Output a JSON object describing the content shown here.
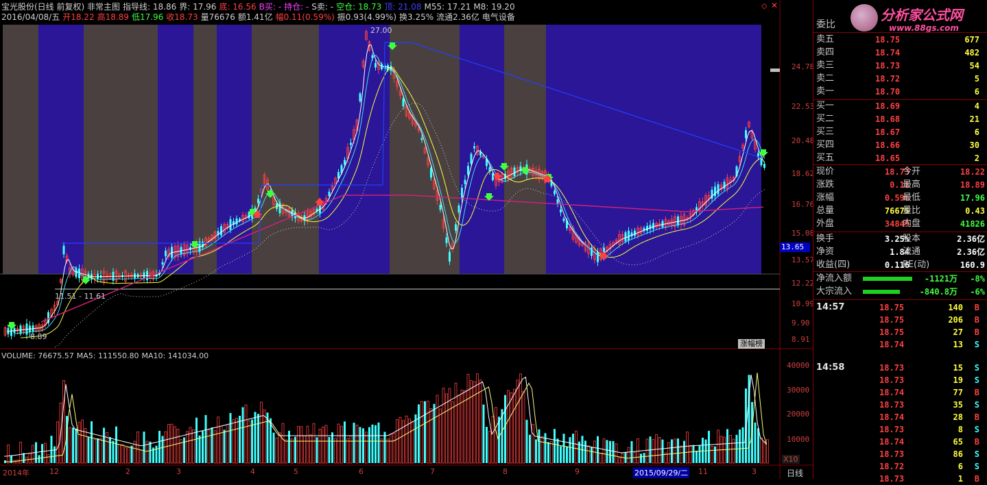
{
  "header": {
    "line1": [
      {
        "text": "宝光股份(日线 前复权) 非常主图",
        "color": "#d0d0d0"
      },
      {
        "text": "指导线: 18.86",
        "color": "#d0d0d0"
      },
      {
        "text": "界: 17.96",
        "color": "#d0d0d0"
      },
      {
        "text": "底: 16.56",
        "color": "#ff4040"
      },
      {
        "text": "B买: -",
        "color": "#ff40ff"
      },
      {
        "text": "持仓: -",
        "color": "#ff40ff"
      },
      {
        "text": "S卖: -",
        "color": "#d0d0d0"
      },
      {
        "text": "空仓: 18.73",
        "color": "#40ff40"
      },
      {
        "text": "顶: 21.08",
        "color": "#4040ff"
      },
      {
        "text": "M55: 17.21",
        "color": "#d0d0d0"
      },
      {
        "text": "M8: 19.20",
        "color": "#d0d0d0"
      }
    ],
    "line2": [
      {
        "text": "2016/04/08/五",
        "color": "#d0d0d0"
      },
      {
        "text": "开18.22",
        "color": "#ff4040"
      },
      {
        "text": "高18.89",
        "color": "#ff4040"
      },
      {
        "text": "低17.96",
        "color": "#40ff40"
      },
      {
        "text": "收18.73",
        "color": "#ff4040"
      },
      {
        "text": "量76676",
        "color": "#d0d0d0"
      },
      {
        "text": "额1.41亿",
        "color": "#d0d0d0"
      },
      {
        "text": "幅0.11(0.59%)",
        "color": "#ff4040"
      },
      {
        "text": "振0.93(4.99%)",
        "color": "#d0d0d0"
      },
      {
        "text": "换3.25%",
        "color": "#d0d0d0"
      },
      {
        "text": "流通2.36亿",
        "color": "#d0d0d0"
      },
      {
        "text": "电气设备",
        "color": "#d0d0d0"
      }
    ]
  },
  "price_axis": [
    "24.78",
    "22.53",
    "20.48",
    "18.62",
    "16.76",
    "15.08",
    "13.57",
    "12.22",
    "10.99",
    "9.90",
    "8.91"
  ],
  "current_price_tag": "13.65",
  "annotations": {
    "high": "27.00",
    "low": "8.89",
    "range": "11.51 - 11.61",
    "rank_button": "涨幅榜"
  },
  "volume": {
    "header": [
      {
        "text": "VOLUME: 76675.57",
        "color": "#d0d0d0"
      },
      {
        "text": "MA5: 111550.80",
        "color": "#d0d0d0"
      },
      {
        "text": "MA10: 141034.00",
        "color": "#d0d0d0"
      }
    ],
    "axis": [
      "40000",
      "30000",
      "20000",
      "10000"
    ],
    "unit": "X10"
  },
  "date_axis": [
    "2014年",
    "12",
    "2",
    "3",
    "4",
    "5",
    "6",
    "7",
    "8",
    "9",
    "2015/09/29/二",
    "11",
    "3"
  ],
  "period_label": "日线",
  "panel": {
    "weibi_label": "委比",
    "asks": [
      {
        "label": "卖五",
        "price": "18.75",
        "vol": "677"
      },
      {
        "label": "卖四",
        "price": "18.74",
        "vol": "482"
      },
      {
        "label": "卖三",
        "price": "18.73",
        "vol": "54"
      },
      {
        "label": "卖二",
        "price": "18.72",
        "vol": "5"
      },
      {
        "label": "卖一",
        "price": "18.70",
        "vol": "6"
      }
    ],
    "bids": [
      {
        "label": "买一",
        "price": "18.69",
        "vol": "4"
      },
      {
        "label": "买二",
        "price": "18.68",
        "vol": "21"
      },
      {
        "label": "买三",
        "price": "18.67",
        "vol": "6"
      },
      {
        "label": "买四",
        "price": "18.66",
        "vol": "30"
      },
      {
        "label": "买五",
        "price": "18.65",
        "vol": "2"
      }
    ],
    "stats1": [
      {
        "l1": "现价",
        "v1": "18.73",
        "c1": "#ff4040",
        "l2": "今开",
        "v2": "18.22",
        "c2": "#ff4040"
      },
      {
        "l1": "涨跌",
        "v1": "0.11",
        "c1": "#ff4040",
        "l2": "最高",
        "v2": "18.89",
        "c2": "#ff4040"
      },
      {
        "l1": "涨幅",
        "v1": "0.59%",
        "c1": "#ff4040",
        "l2": "最低",
        "v2": "17.96",
        "c2": "#40ff40"
      },
      {
        "l1": "总量",
        "v1": "76675",
        "c1": "#ffff40",
        "l2": "量比",
        "v2": "0.43",
        "c2": "#ffff40"
      },
      {
        "l1": "外盘",
        "v1": "34849",
        "c1": "#ff4040",
        "l2": "内盘",
        "v2": "41826",
        "c2": "#40ff40"
      }
    ],
    "stats2": [
      {
        "l1": "换手",
        "v1": "3.25%",
        "c1": "#ffffff",
        "l2": "股本",
        "v2": "2.36亿",
        "c2": "#ffffff"
      },
      {
        "l1": "净资",
        "v1": "1.84",
        "c1": "#ffffff",
        "l2": "流通",
        "v2": "2.36亿",
        "c2": "#ffffff"
      },
      {
        "l1": "收益(四)",
        "v1": "0.116",
        "c1": "#ffffff",
        "l2": "PE(动)",
        "v2": "160.9",
        "c2": "#ffffff"
      }
    ],
    "flows": [
      {
        "label": "净流入额",
        "value": "-1121万",
        "pct": "-8%",
        "fill": 0.8
      },
      {
        "label": "大宗流入",
        "value": "-840.8万",
        "pct": "-6%",
        "fill": 0.6
      }
    ],
    "ticks": [
      {
        "time": "14:57",
        "price": "18.75",
        "vol": "140",
        "side": "B"
      },
      {
        "time": "",
        "price": "18.75",
        "vol": "206",
        "side": "B"
      },
      {
        "time": "",
        "price": "18.75",
        "vol": "27",
        "side": "B"
      },
      {
        "time": "",
        "price": "18.74",
        "vol": "13",
        "side": "S"
      },
      {
        "time": "14:58",
        "price": "18.73",
        "vol": "15",
        "side": "S"
      },
      {
        "time": "",
        "price": "18.73",
        "vol": "19",
        "side": "S"
      },
      {
        "time": "",
        "price": "18.74",
        "vol": "77",
        "side": "B"
      },
      {
        "time": "",
        "price": "18.73",
        "vol": "35",
        "side": "S"
      },
      {
        "time": "",
        "price": "18.74",
        "vol": "28",
        "side": "B"
      },
      {
        "time": "",
        "price": "18.73",
        "vol": "8",
        "side": "S"
      },
      {
        "time": "",
        "price": "18.74",
        "vol": "65",
        "side": "B"
      },
      {
        "time": "",
        "price": "18.73",
        "vol": "86",
        "side": "S"
      },
      {
        "time": "",
        "price": "18.72",
        "vol": "6",
        "side": "S"
      },
      {
        "time": "",
        "price": "18.73",
        "vol": "1",
        "side": "B"
      }
    ]
  },
  "watermark": {
    "title": "分析家公式网",
    "url": "www.88gs.com"
  },
  "colors": {
    "up": "#ff4040",
    "down": "#40ffff",
    "bg": "#000000",
    "band_blue": "#2a1696",
    "band_gray": "#4a4040",
    "grid": "#8a0000"
  }
}
